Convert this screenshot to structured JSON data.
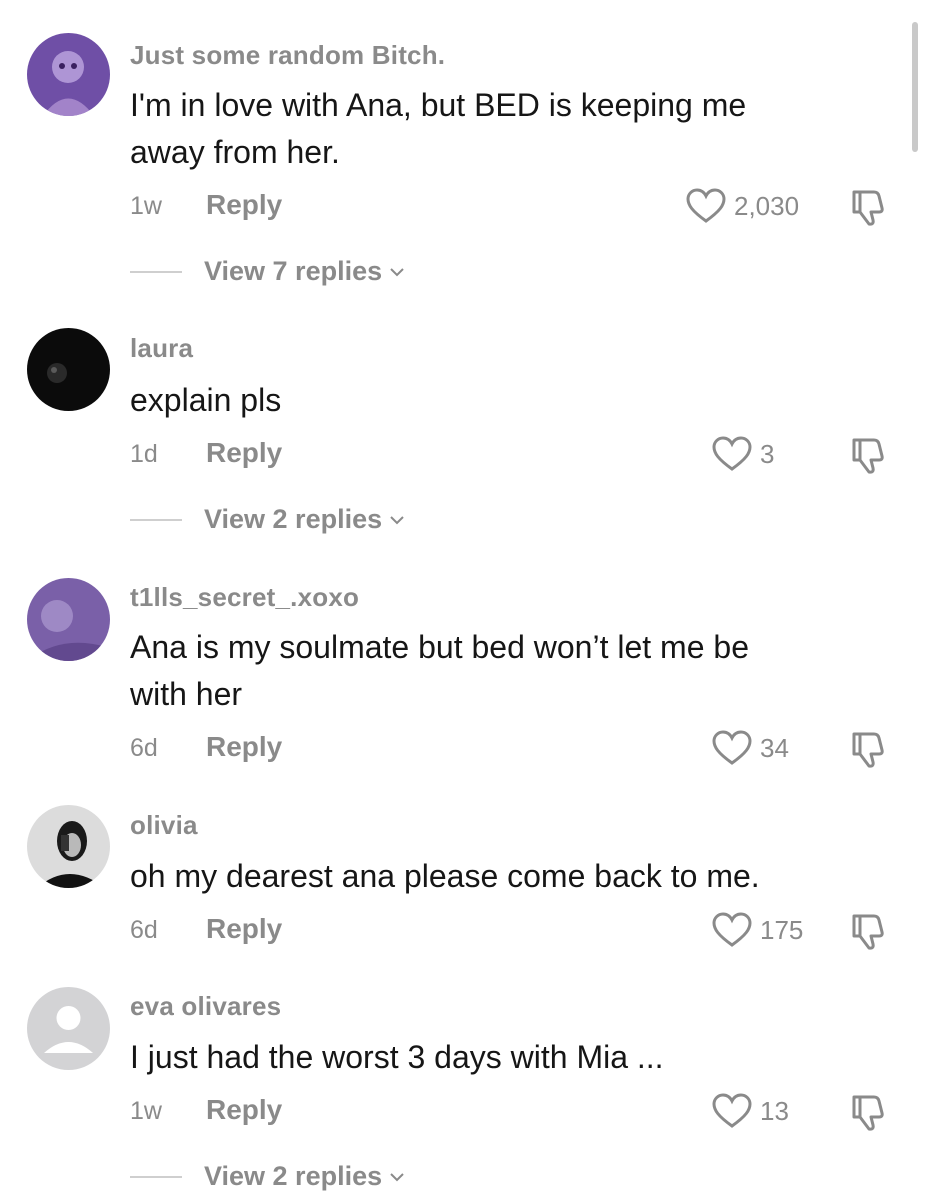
{
  "comments": [
    {
      "username": "Just some random Bitch.",
      "text_lines": [
        "I'm in love with Ana, but BED is keeping me",
        "away from her."
      ],
      "time": "1w",
      "reply_label": "Reply",
      "likes": "2,030",
      "view_replies": "View 7 replies"
    },
    {
      "username": "laura",
      "text_lines": [
        "explain pls"
      ],
      "time": "1d",
      "reply_label": "Reply",
      "likes": "3",
      "view_replies": "View 2 replies"
    },
    {
      "username": "t1lls_secret_.xoxo",
      "text_lines": [
        "Ana is my soulmate but bed won’t let me be",
        "with her"
      ],
      "time": "6d",
      "reply_label": "Reply",
      "likes": "34"
    },
    {
      "username": "olivia",
      "text_lines": [
        "oh my dearest ana please come back to me."
      ],
      "time": "6d",
      "reply_label": "Reply",
      "likes": "175"
    },
    {
      "username": "eva olivares",
      "text_lines": [
        "I just had the worst 3 days with Mia ..."
      ],
      "time": "1w",
      "reply_label": "Reply",
      "likes": "13",
      "view_replies": "View 2 replies"
    }
  ],
  "icons": {
    "like": "heart-outline-icon",
    "dislike": "thumbs-down-icon",
    "expand": "chevron-down-icon"
  },
  "colors": {
    "text": "#161616",
    "muted": "#8a8a8a",
    "divider": "#cfcfcf"
  }
}
